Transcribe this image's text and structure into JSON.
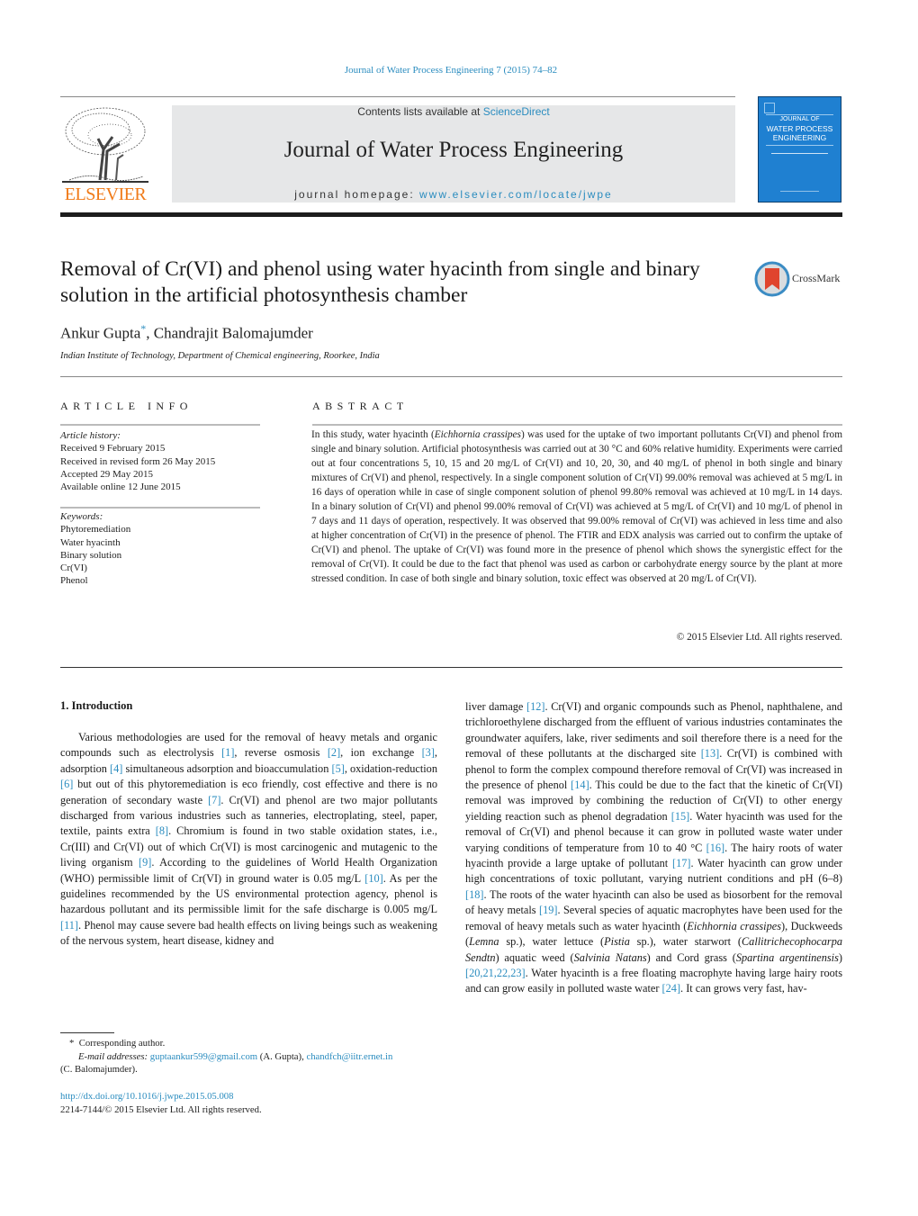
{
  "header": {
    "citation": "Journal of Water Process Engineering 7 (2015) 74–82",
    "contents_prefix": "Contents lists available at ",
    "contents_link": "ScienceDirect",
    "journal_title": "Journal of Water Process Engineering",
    "homepage_prefix": "journal homepage: ",
    "homepage_link": "www.elsevier.com/locate/jwpe",
    "publisher_logo_text": "ELSEVIER",
    "cover": {
      "line1": "JOURNAL OF",
      "line2": "WATER PROCESS",
      "line3": "ENGINEERING"
    },
    "colors": {
      "link": "#2a8cbf",
      "elsevier_orange": "#f07a18",
      "cover_blue": "#1f80d1",
      "masthead_gray": "#e6e7e8"
    }
  },
  "article": {
    "title": "Removal of Cr(VI) and phenol using water hyacinth from single and binary solution in the artificial photosynthesis chamber",
    "crossmark_label": "CrossMark",
    "authors": [
      {
        "name": "Ankur Gupta",
        "marker": "*"
      },
      {
        "name": "Chandrajit Balomajumder",
        "marker": ""
      }
    ],
    "author_separator": ", ",
    "affiliation": "Indian Institute of Technology, Department of Chemical engineering, Roorkee, India"
  },
  "article_info": {
    "heading": "ARTICLE INFO",
    "history_label": "Article history:",
    "history": [
      "Received 9 February 2015",
      "Received in revised form 26 May 2015",
      "Accepted 29 May 2015",
      "Available online 12 June 2015"
    ],
    "keywords_label": "Keywords:",
    "keywords": [
      "Phytoremediation",
      "Water hyacinth",
      "Binary solution",
      "Cr(VI)",
      "Phenol"
    ]
  },
  "abstract": {
    "heading": "ABSTRACT",
    "text_1": "In this study, water hyacinth (",
    "species": "Eichhornia crassipes",
    "text_2": ") was used for the uptake of two important pollutants Cr(VI) and phenol from single and binary solution. Artificial photosynthesis was carried out at 30 °C and 60% relative humidity. Experiments were carried out at four concentrations 5, 10, 15 and 20 mg/L of Cr(VI) and 10, 20, 30, and 40 mg/L of phenol in both single and binary mixtures of Cr(VI) and phenol, respectively. In a single component solution of Cr(VI) 99.00% removal was achieved at 5 mg/L in 16 days of operation while in case of single component solution of phenol 99.80% removal was achieved at 10 mg/L in 14 days. In a binary solution of Cr(VI) and phenol 99.00% removal of Cr(VI) was achieved at 5 mg/L of Cr(VI) and 10 mg/L of phenol in 7 days and 11 days of operation, respectively. It was observed that 99.00% removal of Cr(VI) was achieved in less time and also at higher concentration of Cr(VI) in the presence of phenol. The FTIR and EDX analysis was carried out to confirm the uptake of Cr(VI) and phenol. The uptake of Cr(VI) was found more in the presence of phenol which shows the synergistic effect for the removal of Cr(VI). It could be due to the fact that phenol was used as carbon or carbohydrate energy source by the plant at more stressed condition. In case of both single and binary solution, toxic effect was observed at 20 mg/L of Cr(VI).",
    "copyright": "© 2015 Elsevier Ltd. All rights reserved."
  },
  "body": {
    "section_heading": "1.  Introduction",
    "left": [
      {
        "t": "Various methodologies are used for the removal of heavy metals and organic compounds such as electrolysis "
      },
      {
        "r": "[1]"
      },
      {
        "t": ", reverse osmosis "
      },
      {
        "r": "[2]"
      },
      {
        "t": ", ion exchange "
      },
      {
        "r": "[3]"
      },
      {
        "t": ", adsorption "
      },
      {
        "r": "[4]"
      },
      {
        "t": " simultaneous adsorption and bioaccumulation "
      },
      {
        "r": "[5]"
      },
      {
        "t": ", oxidation-reduction "
      },
      {
        "r": "[6]"
      },
      {
        "t": " but out of this phytoremediation is eco friendly, cost effective and there is no generation of secondary waste "
      },
      {
        "r": "[7]"
      },
      {
        "t": ". Cr(VI) and phenol are two major pollutants discharged from various industries such as tanneries, electroplating, steel, paper, textile, paints extra "
      },
      {
        "r": "[8]"
      },
      {
        "t": ". Chromium is found in two stable oxidation states, i.e., Cr(III) and Cr(VI) out of which Cr(VI) is most carcinogenic and mutagenic to the living organism "
      },
      {
        "r": "[9]"
      },
      {
        "t": ". According to the guidelines of World Health Organization (WHO) permissible limit of Cr(VI) in ground water is 0.05 mg/L "
      },
      {
        "r": "[10]"
      },
      {
        "t": ". As per the guidelines recommended by the US environmental protection agency, phenol is hazardous pollutant and its permissible limit for the safe discharge is 0.005 mg/L "
      },
      {
        "r": "[11]"
      },
      {
        "t": ". Phenol may cause severe bad health effects on living beings such as weakening of the nervous system, heart disease, kidney and"
      }
    ],
    "right": [
      {
        "t": "liver damage "
      },
      {
        "r": "[12]"
      },
      {
        "t": ". Cr(VI) and organic compounds such as Phenol, naphthalene, and trichloroethylene discharged from the effluent of various industries contaminates the groundwater aquifers, lake, river sediments and soil therefore there is a need for the removal of these pollutants at the discharged site "
      },
      {
        "r": "[13]"
      },
      {
        "t": ". Cr(VI) is combined with phenol to form the complex compound therefore removal of Cr(VI) was increased in the presence of phenol "
      },
      {
        "r": "[14]"
      },
      {
        "t": ". This could be due to the fact that the kinetic of Cr(VI) removal was improved by combining the reduction of Cr(VI) to other energy yielding reaction such as phenol degradation "
      },
      {
        "r": "[15]"
      },
      {
        "t": ". Water hyacinth was used for the removal of Cr(VI) and phenol because it can grow in polluted waste water under varying conditions of temperature from 10 to 40 °C "
      },
      {
        "r": "[16]"
      },
      {
        "t": ". The hairy roots of water hyacinth provide a large uptake of pollutant "
      },
      {
        "r": "[17]"
      },
      {
        "t": ". Water hyacinth can grow under high concentrations of toxic pollutant, varying nutrient conditions and pH (6–8) "
      },
      {
        "r": "[18]"
      },
      {
        "t": ". The roots of the water hyacinth can also be used as biosorbent for the removal of heavy metals "
      },
      {
        "r": "[19]"
      },
      {
        "t": ". Several species of aquatic macrophytes have been used for the removal of heavy metals such as water hyacinth ("
      },
      {
        "i": "Eichhornia crassipes"
      },
      {
        "t": "), Duckweeds ("
      },
      {
        "i": "Lemna"
      },
      {
        "t": " sp.), water lettuce ("
      },
      {
        "i": "Pistia"
      },
      {
        "t": " sp.), water starwort ("
      },
      {
        "i": "Callitrichecophocarpa Sendtn"
      },
      {
        "t": ") aquatic weed ("
      },
      {
        "i": "Salvinia Natans"
      },
      {
        "t": ") and Cord grass ("
      },
      {
        "i": "Spartina argentinensis"
      },
      {
        "t": ") "
      },
      {
        "r": "[20,21,22,23]"
      },
      {
        "t": ". Water hyacinth is a free floating macrophyte having large hairy roots and can grow easily in polluted waste water "
      },
      {
        "r": "[24]"
      },
      {
        "t": ". It can grows very fast, hav-"
      }
    ]
  },
  "footnote": {
    "marker": "*",
    "corresponding": "Corresponding author.",
    "email_label": "E-mail addresses:",
    "email_1": "guptaankur599@gmail.com",
    "email_1_owner": " (A. Gupta), ",
    "email_2": "chandfch@iitr.ernet.in",
    "email_2_owner": "(C. Balomajumder).",
    "doi": "http://dx.doi.org/10.1016/j.jwpe.2015.05.008",
    "issn_copyright": "2214-7144/© 2015 Elsevier Ltd. All rights reserved."
  }
}
